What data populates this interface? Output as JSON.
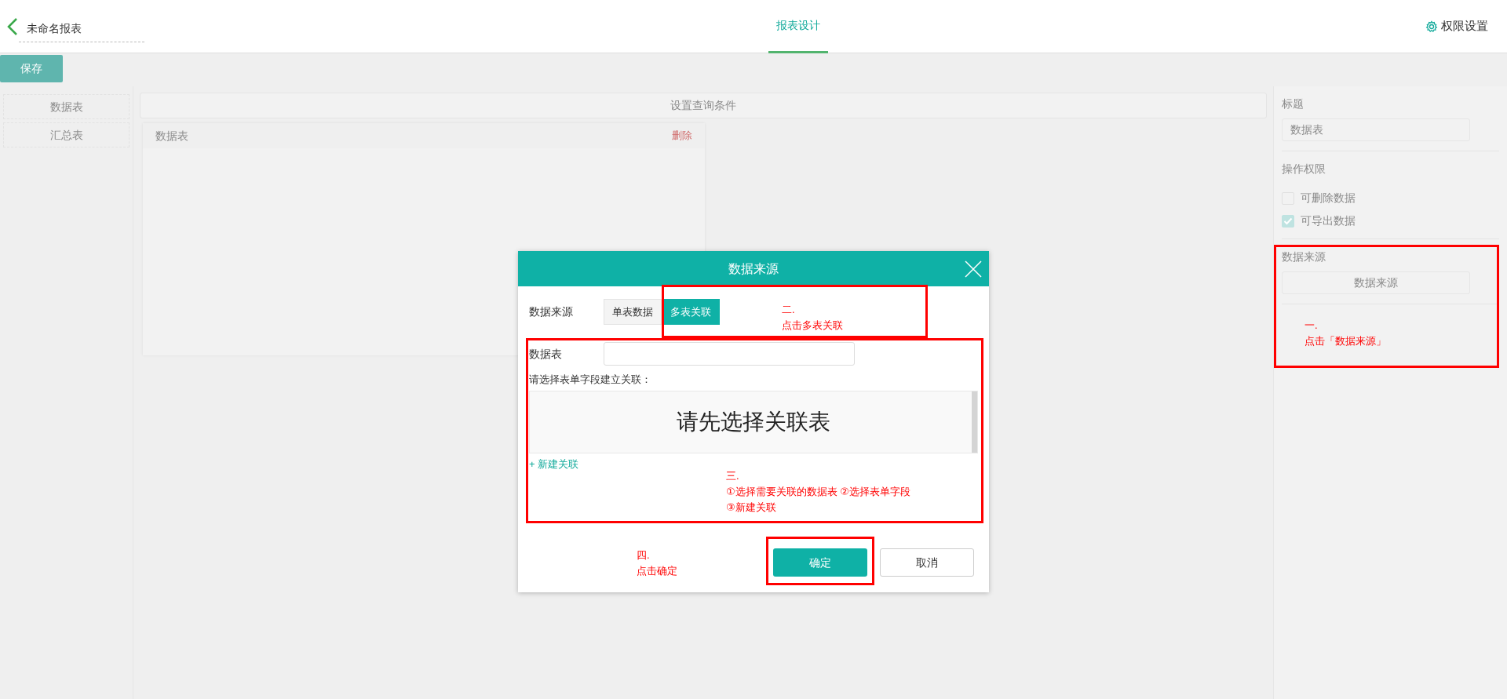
{
  "header": {
    "title": "未命名报表",
    "tabs": [
      {
        "label": "报表设计",
        "selected": true
      }
    ],
    "settings_link": "权限设置"
  },
  "toolbar": {
    "save_button": "保存"
  },
  "sidebar": {
    "items": [
      {
        "label": "数据表"
      },
      {
        "label": "汇总表"
      }
    ]
  },
  "canvas": {
    "query_bar": "设置查询条件",
    "card": {
      "title": "数据表",
      "delete_link": "删除"
    }
  },
  "properties": {
    "title_label": "标题",
    "title_value": "数据表",
    "permissions_label": "操作权限",
    "permissions": [
      {
        "label": "可删除数据",
        "checked": false
      },
      {
        "label": "可导出数据",
        "checked": true
      }
    ],
    "source_label": "数据来源",
    "source_button": "数据来源"
  },
  "dialog": {
    "title": "数据来源",
    "source_label": "数据来源",
    "source_options": [
      {
        "label": "单表数据",
        "selected": false
      },
      {
        "label": "多表关联",
        "selected": true
      }
    ],
    "table_label": "数据表",
    "relation_label": "请选择表单字段建立关联：",
    "empty_message": "请先选择关联表",
    "add_link": "+ 新建关联",
    "buttons": [
      {
        "label": "确定",
        "kind": "primary"
      },
      {
        "label": "取消",
        "kind": "secondary"
      }
    ]
  },
  "annotations": [
    {
      "lines": [
        "一.",
        "点击「数据来源」"
      ]
    },
    {
      "lines": [
        "二.",
        "点击多表关联"
      ]
    },
    {
      "lines": [
        "三.",
        "①选择需要关联的数据表 ②选择表单字段",
        "③新建关联"
      ]
    },
    {
      "lines": [
        "四.",
        "点击确定"
      ]
    }
  ]
}
